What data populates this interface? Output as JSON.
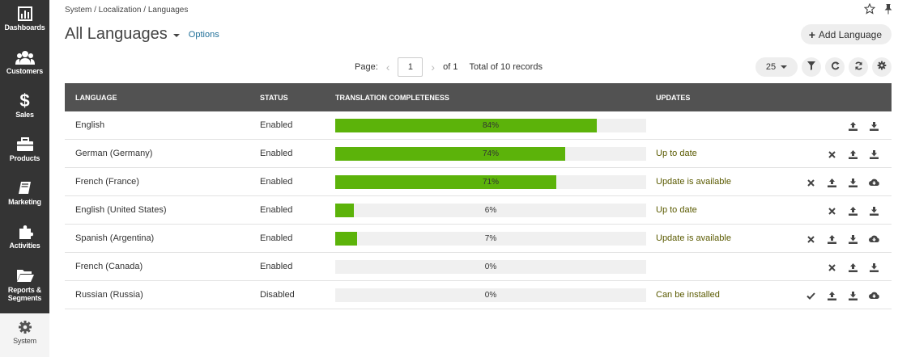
{
  "sidebar": {
    "items": [
      {
        "label": "Dashboards",
        "icon": "bar-chart-icon"
      },
      {
        "label": "Customers",
        "icon": "users-icon"
      },
      {
        "label": "Sales",
        "icon": "dollar-icon"
      },
      {
        "label": "Products",
        "icon": "briefcase-icon"
      },
      {
        "label": "Marketing",
        "icon": "book-icon"
      },
      {
        "label": "Activities",
        "icon": "puzzle-icon"
      },
      {
        "label": "Reports & Segments",
        "icon": "folder-icon"
      },
      {
        "label": "System",
        "icon": "gear-icon"
      }
    ]
  },
  "header": {
    "breadcrumb": "System / Localization / Languages",
    "title": "All Languages",
    "options_label": "Options",
    "add_label": "Add Language"
  },
  "pager": {
    "page_label": "Page:",
    "page_value": "1",
    "of_label": "of 1",
    "total_label": "Total of 10 records",
    "page_size": "25"
  },
  "table": {
    "columns": [
      "LANGUAGE",
      "STATUS",
      "TRANSLATION COMPLETENESS",
      "UPDATES"
    ],
    "rows": [
      {
        "language": "English",
        "status": "Enabled",
        "completeness": 84,
        "pct_label": "84%",
        "update": "",
        "actions": [
          "upload",
          "download"
        ]
      },
      {
        "language": "German (Germany)",
        "status": "Enabled",
        "completeness": 74,
        "pct_label": "74%",
        "update": "Up to date",
        "actions": [
          "remove",
          "upload",
          "download"
        ]
      },
      {
        "language": "French (France)",
        "status": "Enabled",
        "completeness": 71,
        "pct_label": "71%",
        "update": "Update is available",
        "actions": [
          "remove",
          "upload",
          "download",
          "cloud-download"
        ]
      },
      {
        "language": "English (United States)",
        "status": "Enabled",
        "completeness": 6,
        "pct_label": "6%",
        "update": "Up to date",
        "actions": [
          "remove",
          "upload",
          "download"
        ]
      },
      {
        "language": "Spanish (Argentina)",
        "status": "Enabled",
        "completeness": 7,
        "pct_label": "7%",
        "update": "Update is available",
        "actions": [
          "remove",
          "upload",
          "download",
          "cloud-download"
        ]
      },
      {
        "language": "French (Canada)",
        "status": "Enabled",
        "completeness": 0,
        "pct_label": "0%",
        "update": "",
        "actions": [
          "remove",
          "upload",
          "download"
        ]
      },
      {
        "language": "Russian (Russia)",
        "status": "Disabled",
        "completeness": 0,
        "pct_label": "0%",
        "update": "Can be installed",
        "actions": [
          "install",
          "upload",
          "download",
          "cloud-download"
        ]
      }
    ]
  },
  "colors": {
    "sidebar": "#343434",
    "header_row": "#525252",
    "progress_fill": "#5cb30a",
    "link": "#1f6f98"
  }
}
